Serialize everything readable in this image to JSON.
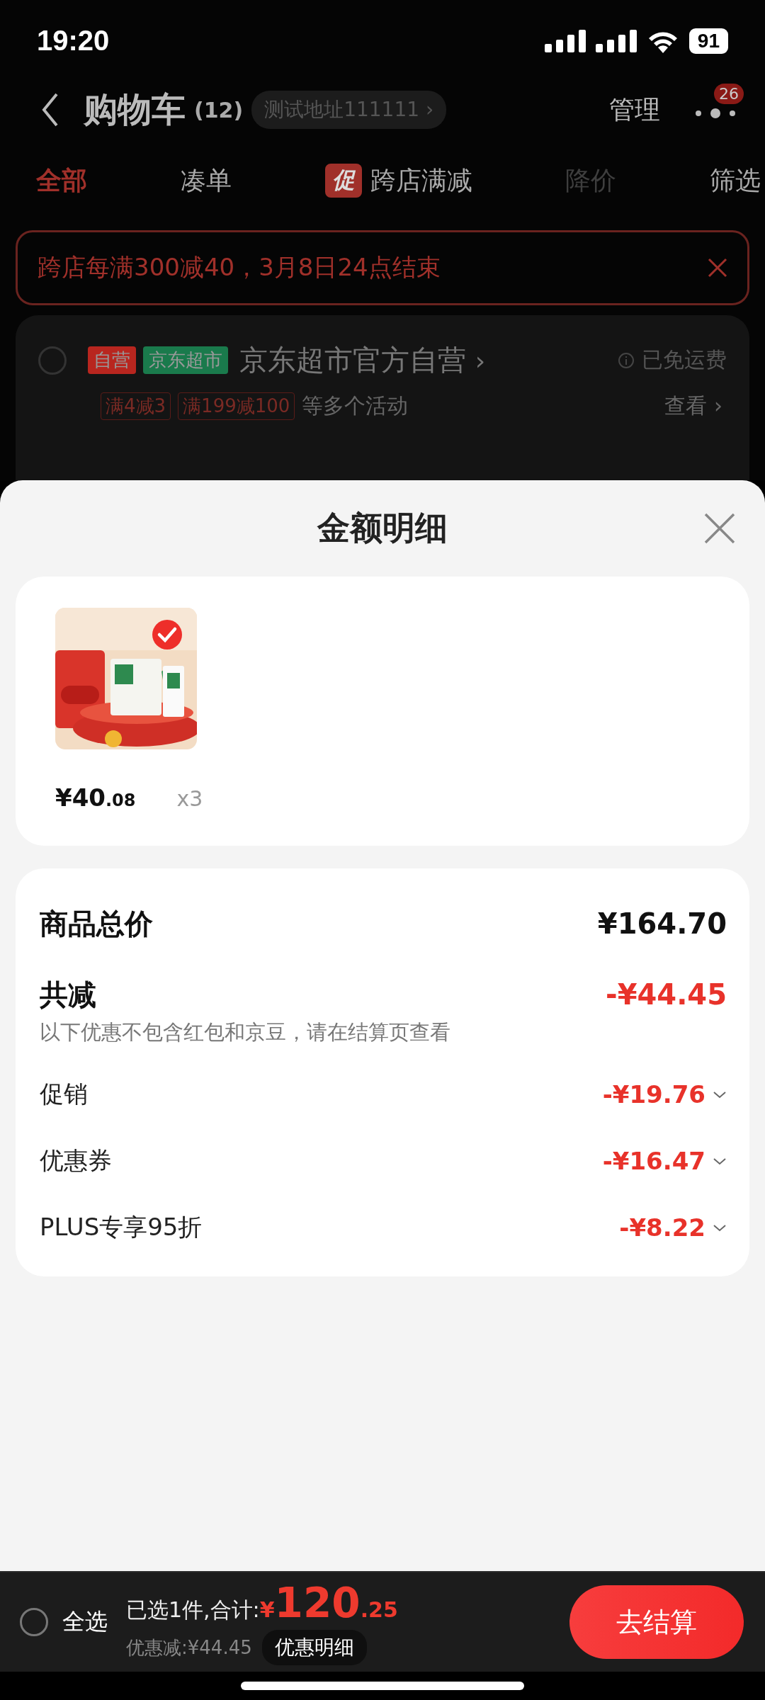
{
  "status_bar": {
    "time": "19:20",
    "battery": "91"
  },
  "nav": {
    "title": "购物车",
    "count": "(12)",
    "address": "测试地址111111",
    "address_chevron": "›",
    "manage": "管理",
    "badge": "26"
  },
  "tabs": [
    {
      "label": "全部",
      "selected": true,
      "disabled": false
    },
    {
      "label": "凑单",
      "selected": false,
      "disabled": false
    },
    {
      "label": "跨店满减",
      "tag": "促",
      "selected": false,
      "disabled": false
    },
    {
      "label": "降价",
      "selected": false,
      "disabled": true
    },
    {
      "label": "筛选",
      "selected": false,
      "disabled": false
    }
  ],
  "banner": {
    "text": "跨店每满300减40，3月8日24点结束"
  },
  "store": {
    "checked": false,
    "tags": [
      {
        "label": "自营",
        "color": "#b8261f"
      },
      {
        "label": "京东超市",
        "color": "#1a7a4c"
      }
    ],
    "name": "京东超市官方自营",
    "chevron": "›",
    "shipping": "已免运费",
    "promos": [
      "满4减3",
      "满199减100"
    ],
    "promo_suffix": "等多个活动",
    "view": "查看",
    "view_chevron": "›"
  },
  "sheet": {
    "title": "金额明细",
    "items": [
      {
        "kind": "picture",
        "checked": true,
        "price_int": "¥40",
        "price_dec": ".08",
        "qty": "x3"
      }
    ],
    "summary": [
      {
        "kind": "total",
        "label": "商品总价",
        "value": "¥164.70"
      },
      {
        "kind": "discount",
        "label": "共减",
        "value": "-¥44.45",
        "note": "以下优惠不包含红包和京豆，请在结算页查看"
      },
      {
        "kind": "item",
        "label": "促销",
        "value": "-¥19.76",
        "expanded": false
      },
      {
        "kind": "item",
        "label": "优惠券",
        "value": "-¥16.47",
        "expanded": false
      },
      {
        "kind": "item",
        "label": "PLUS专享95折",
        "value": "-¥8.22",
        "expanded": false
      }
    ]
  },
  "bottom_bar": {
    "select_all": "全选",
    "checked": false,
    "selected_label": "已选1件,合计:",
    "currency": "¥",
    "total_int": "120",
    "total_dec": ".25",
    "saved": "优惠减:¥44.45",
    "detail_button": "优惠明细",
    "checkout": "去结算"
  }
}
